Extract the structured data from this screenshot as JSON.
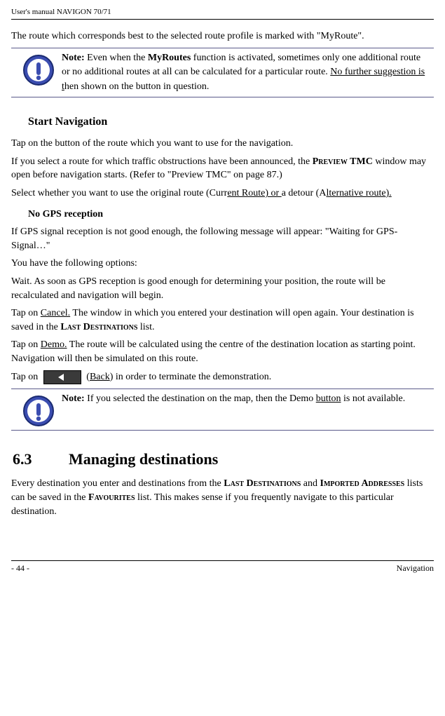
{
  "header": {
    "title": "User's manual NAVIGON 70/71"
  },
  "intro": "The route which corresponds best to the selected route profile is marked with \"MyRoute\".",
  "note1": {
    "label": "Note:",
    "pre": " Even when the ",
    "b1": "MyRoutes",
    "rest": " function is activated, sometimes only one additional route or no additional routes at all can be calculated for a particular route. ",
    "u1": "No further suggestion is t",
    "tail": "hen shown on the button in question."
  },
  "start_nav": {
    "title": "Start Navigation",
    "tap1": "Tap on the button of the route which you want to use for the navigation.",
    "p1a": "If you select a route for which traffic obstructions have been announced, the ",
    "p1b": "Preview TMC",
    "p1c": " window may open before navigation starts. (Refer to \"Preview TMC\" on page 87.)",
    "sel_a": "Select whether you want to use the original route (Curr",
    "sel_u1": "ent Route) or   ",
    "sel_b": "a detour (A",
    "sel_u2": "lternative route).  "
  },
  "no_gps": {
    "title": "No GPS reception",
    "p1": "If GPS signal reception is not good enough, the following message will appear: \"Waiting for GPS-Signal…\"",
    "p2": "You have the following options:",
    "opt1": "Wait. As soon as GPS reception is good enough for determining your position, the route will be recalculated and navigation will begin.",
    "opt2_a": "Tap on ",
    "opt2_u": "Cancel.",
    "opt2_b": " The window in which you entered your destination will open again. Your destination is saved in the ",
    "opt2_sc": "Last Destinations",
    "opt2_c": " list.",
    "opt3_a": "Tap on ",
    "opt3_u": "Demo.",
    "opt3_b": " The route will be calculated using the centre of the destination location as starting point. Navigation will then be simulated on this route.",
    "opt4_a": "Tap on ",
    "opt4_mid": " (",
    "opt4_u": "Back",
    "opt4_b": ") in order to terminate the demonstration."
  },
  "note2": {
    "label": "Note:",
    "a": " If you selected the destination on the map, then the Demo ",
    "u": "button",
    "b": " is not available."
  },
  "section": {
    "num": "6.3",
    "title": "Managing destinations",
    "p_a": "Every destination you enter and destinations from the ",
    "sc1": "Last Destinations",
    "p_b": " and ",
    "sc2": "Imported Addresses",
    "p_c": " lists can be saved in the ",
    "sc3": "Favourites",
    "p_d": " list. This makes sense if you frequently navigate to this particular destination."
  },
  "footer": {
    "left": "- 44 -",
    "right": "Navigation"
  }
}
